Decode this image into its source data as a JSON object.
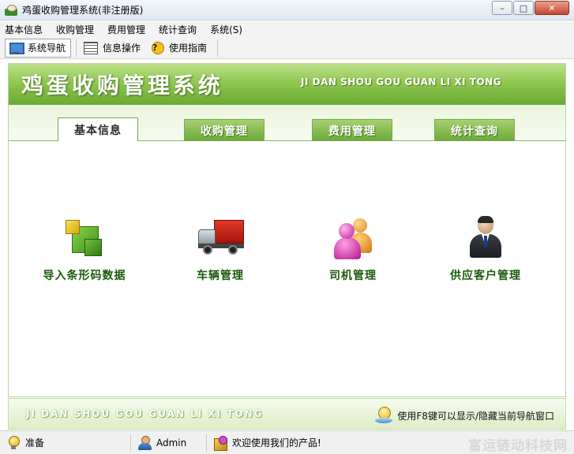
{
  "window": {
    "title": "鸡蛋收购管理系统(非注册版)",
    "controls": {
      "minimize": "–",
      "maximize": "□",
      "close": "✕"
    }
  },
  "menu": [
    "基本信息",
    "收购管理",
    "费用管理",
    "统计查询",
    "系统(S)"
  ],
  "toolbar": {
    "items": [
      {
        "label": "系统导航",
        "icon": "monitor-icon",
        "active": true
      },
      {
        "label": "信息操作",
        "icon": "grid-icon",
        "active": false
      },
      {
        "label": "使用指南",
        "icon": "help-icon",
        "active": false
      }
    ],
    "help_glyph": "?"
  },
  "banner": {
    "title": "鸡蛋收购管理系统",
    "subtitle": "JI DAN SHOU GOU GUAN LI XI TONG"
  },
  "tabs": [
    {
      "label": "基本信息",
      "active": true
    },
    {
      "label": "收购管理",
      "active": false
    },
    {
      "label": "费用管理",
      "active": false
    },
    {
      "label": "统计查询",
      "active": false
    }
  ],
  "features": [
    {
      "label": "导入条形码数据",
      "icon": "cubes-icon"
    },
    {
      "label": "车辆管理",
      "icon": "truck-icon"
    },
    {
      "label": "司机管理",
      "icon": "people-icon"
    },
    {
      "label": "供应客户管理",
      "icon": "businessman-icon"
    }
  ],
  "bottom": {
    "brand": "JI DAN SHOU GOU GUAN LI XI TONG",
    "hint": "使用F8键可以显示/隐藏当前导航窗口"
  },
  "status": {
    "ready": "准备",
    "user": "Admin",
    "welcome": "欢迎使用我们的产品!",
    "watermark": "富运链动科技网"
  },
  "colors": {
    "banner_green": "#6aa933",
    "tab_green": "#8fc751",
    "label_green": "#1a5a0a"
  }
}
